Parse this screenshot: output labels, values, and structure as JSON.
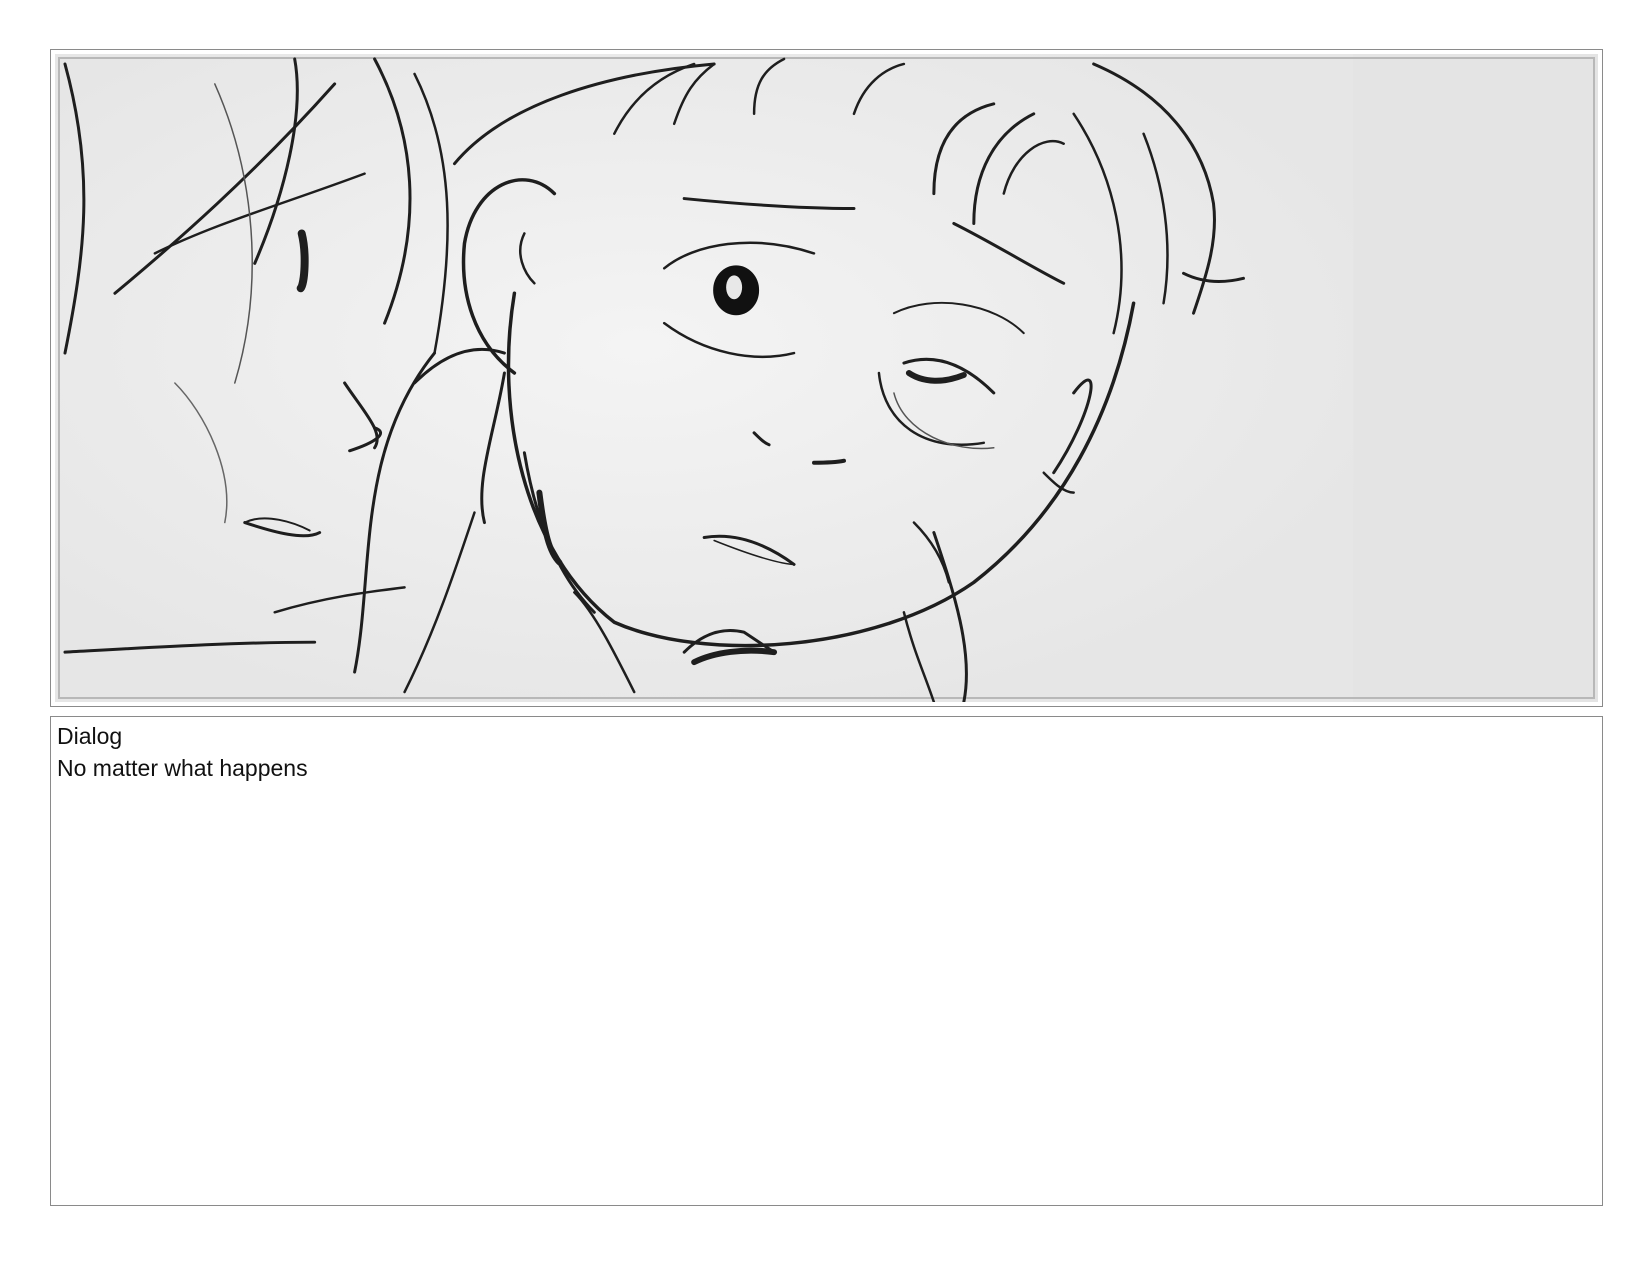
{
  "storyboard": {
    "panel": {
      "image": "storyboard-sketch-child-face-closeup"
    },
    "notes": {
      "label": "Dialog",
      "text": "No matter what happens"
    }
  },
  "colors": {
    "frame_border": "#8a8a8a",
    "sketch_background": "#e8e8e8",
    "sketch_line": "#1e1e1e"
  }
}
